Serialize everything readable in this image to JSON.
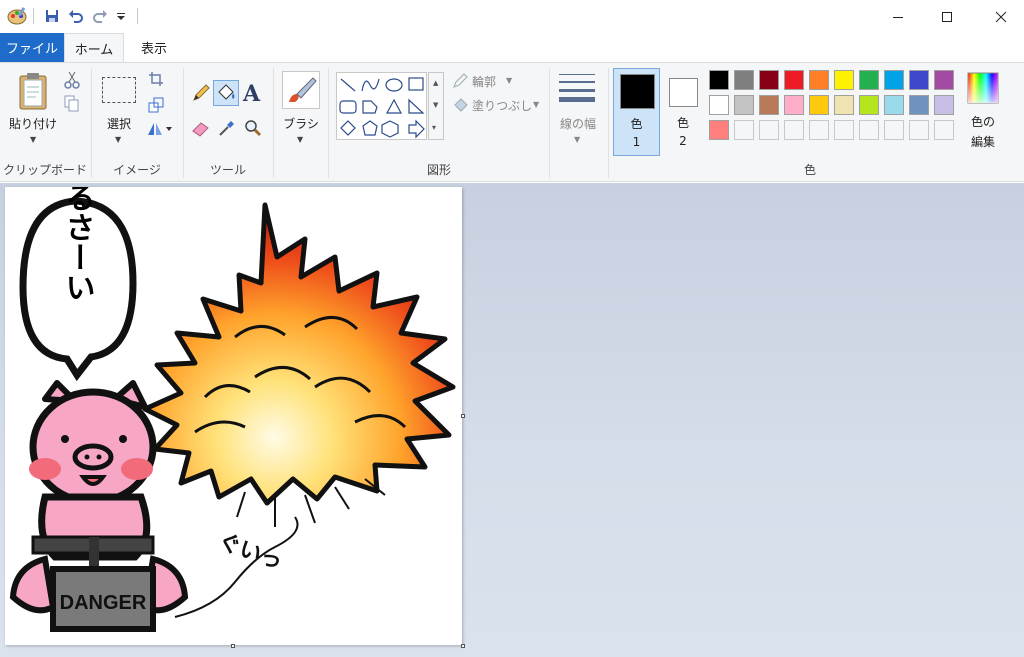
{
  "tabs": {
    "file": "ファイル",
    "home": "ホーム",
    "view": "表示"
  },
  "groups": {
    "clipboard": {
      "label": "クリップボード",
      "paste": "貼り付け"
    },
    "image": {
      "label": "イメージ",
      "select": "選択"
    },
    "tools": {
      "label": "ツール"
    },
    "brushes": {
      "label": "ブラシ"
    },
    "shapes": {
      "label": "図形",
      "outline": "輪郭",
      "fill": "塗りつぶし"
    },
    "size": {
      "label": "線の幅"
    },
    "colors": {
      "label": "色",
      "color1": "色\n1",
      "color1_a": "色",
      "color1_b": "1",
      "color2_a": "色",
      "color2_b": "2",
      "edit_a": "色の",
      "edit_b": "編集"
    }
  },
  "palette_row1": [
    "#000000",
    "#7f7f7f",
    "#880015",
    "#ed1c24",
    "#ff7f27",
    "#fff200",
    "#22b14c",
    "#00a2e8",
    "#3f48cc",
    "#a349a4"
  ],
  "palette_row2": [
    "#ffffff",
    "#c3c3c3",
    "#b97a57",
    "#ffaec9",
    "#ffc90e",
    "#efe4b0",
    "#b5e61d",
    "#99d9ea",
    "#7092be",
    "#c8bfe7"
  ],
  "palette_row3": [
    "#ff7f7f",
    "",
    "",
    "",
    "",
    "",
    "",
    "",
    "",
    ""
  ],
  "primary_color": "#000000",
  "secondary_color": "#ffffff",
  "drawing": {
    "speech": "うるさーい",
    "sign": "DANGER",
    "sfx": "ぐいっ"
  },
  "icons": {
    "app": "paint-icon",
    "save": "save-icon",
    "undo": "undo-icon",
    "redo": "redo-icon",
    "minimize": "minimize-icon",
    "maximize": "maximize-icon",
    "close": "close-icon"
  }
}
